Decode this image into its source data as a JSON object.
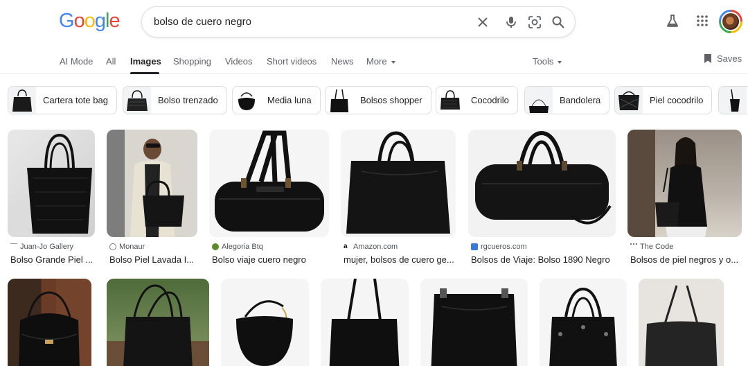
{
  "search": {
    "query": "bolso de cuero negro"
  },
  "tabs": [
    "AI Mode",
    "All",
    "Images",
    "Shopping",
    "Videos",
    "Short videos",
    "News",
    "More"
  ],
  "tools_label": "Tools",
  "saves_label": "Saves",
  "chips": [
    "Cartera tote bag",
    "Bolso trenzado",
    "Media luna",
    "Bolsos shopper",
    "Cocodrilo",
    "Bandolera",
    "Piel cocodrilo"
  ],
  "results": [
    {
      "source": "Juan-Jo Gallery",
      "title": "Bolso Grande Piel ..."
    },
    {
      "source": "Monaur",
      "title": "Bolso Piel Lavada I..."
    },
    {
      "source": "Alegoria Btq",
      "title": "Bolso viaje cuero negro"
    },
    {
      "source": "Amazon.com",
      "title": "mujer, bolsos de cuero ge..."
    },
    {
      "source": "rgcueros.com",
      "title": "Bolsos de Viaje: Bolso 1890 Negro"
    },
    {
      "source": "The Code",
      "title": "Bolsos de piel negros y o..."
    }
  ],
  "colors": {
    "blue": "#4285f4",
    "red": "#ea4335",
    "yellow": "#fbbc05",
    "green": "#34a853",
    "grey": "#5f6368"
  }
}
